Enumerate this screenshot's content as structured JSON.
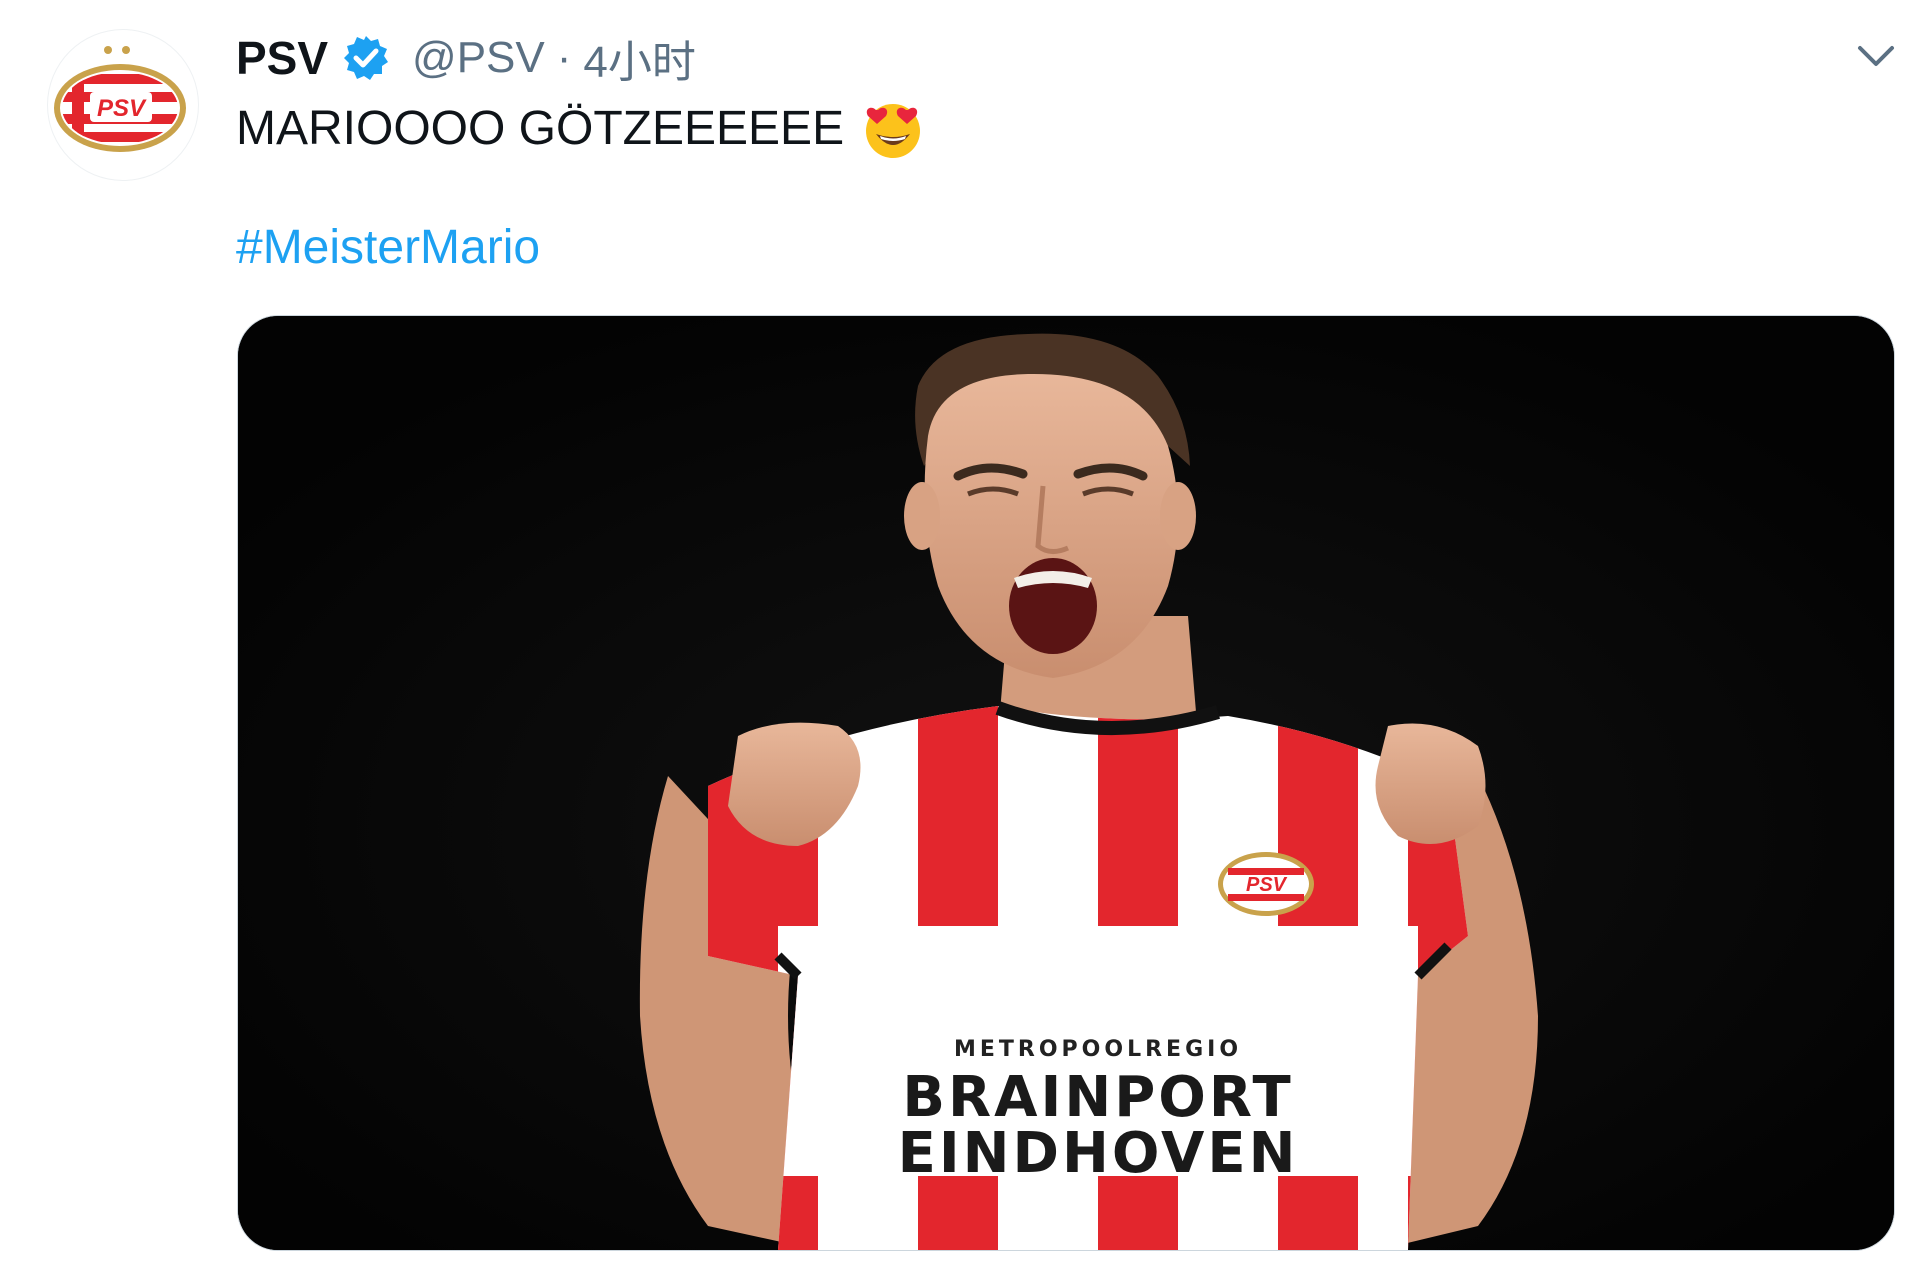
{
  "tweet": {
    "author": {
      "display_name": "PSV",
      "handle": "@PSV",
      "verified": true,
      "avatar_logo_text": "PSV"
    },
    "separator": "·",
    "timestamp": "4小时",
    "text": "MARIOOOO GÖTZEEEEEE",
    "emoji": "heart-eyes-emoji",
    "hashtag": "#MeisterMario",
    "media": {
      "type": "photo",
      "shirt_sponsor_small": "METROPOOLREGIO",
      "shirt_sponsor_line1": "BRAINPORT",
      "shirt_sponsor_line2": "EINDHOVEN",
      "crest_text": "PSV"
    }
  },
  "colors": {
    "accent": "#1da1f2",
    "psv_red": "#e3262d",
    "secondary_text": "#5b7083",
    "media_background": "#050505"
  },
  "icons": {
    "verified": "verified-badge-icon",
    "caret": "chevron-down-icon"
  }
}
